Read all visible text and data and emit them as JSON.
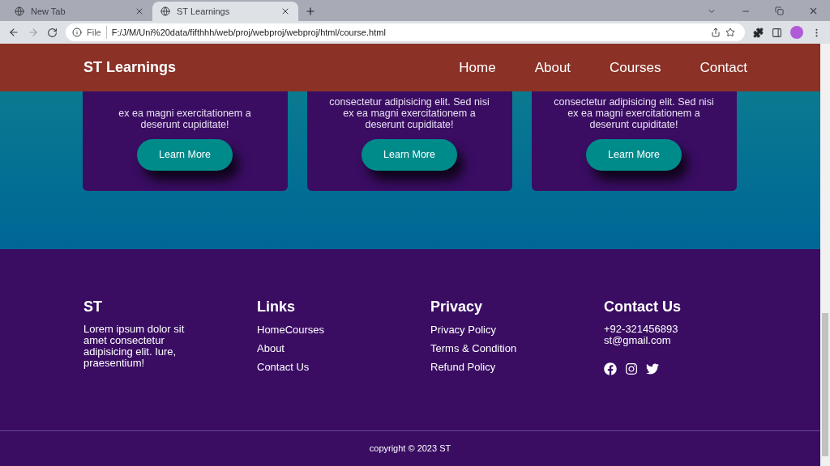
{
  "browser": {
    "tabs": [
      {
        "title": "New Tab",
        "selected": false
      },
      {
        "title": "ST Learnings",
        "selected": true
      }
    ],
    "address": {
      "scheme": "File",
      "url": "F:/J/M/Uni%20data/fifthhh/web/proj/webproj/webproj/html/course.html"
    }
  },
  "navbar": {
    "brand": "ST Learnings",
    "links": [
      "Home",
      "About",
      "Courses",
      "Contact"
    ]
  },
  "cards": [
    {
      "text": "ex ea magni exercitationem a deserunt cupiditate!",
      "button": "Learn More"
    },
    {
      "text": "consectetur adipisicing elit. Sed nisi ex ea magni exercitationem a deserunt cupiditate!",
      "button": "Learn More"
    },
    {
      "text": "consectetur adipisicing elit. Sed nisi ex ea magni exercitationem a deserunt cupiditate!",
      "button": "Learn More"
    }
  ],
  "footer": {
    "columns": [
      {
        "kind": "text",
        "heading": "ST",
        "text": "Lorem ipsum dolor sit amet consectetur adipisicing elit. Iure, praesentium!"
      },
      {
        "kind": "links",
        "heading": "Links",
        "items": [
          "HomeCourses",
          "About",
          "Contact Us"
        ]
      },
      {
        "kind": "links",
        "heading": "Privacy",
        "items": [
          "Privacy Policy",
          "Terms & Condition",
          "Refund Policy"
        ]
      },
      {
        "kind": "contact",
        "heading": "Contact Us",
        "lines": [
          "+92-321456893",
          "st@gmail.com"
        ],
        "social": [
          {
            "kind": "facebook"
          },
          {
            "kind": "instagram"
          },
          {
            "kind": "twitter"
          }
        ]
      }
    ],
    "copyright": "copyright © 2023 ST"
  }
}
